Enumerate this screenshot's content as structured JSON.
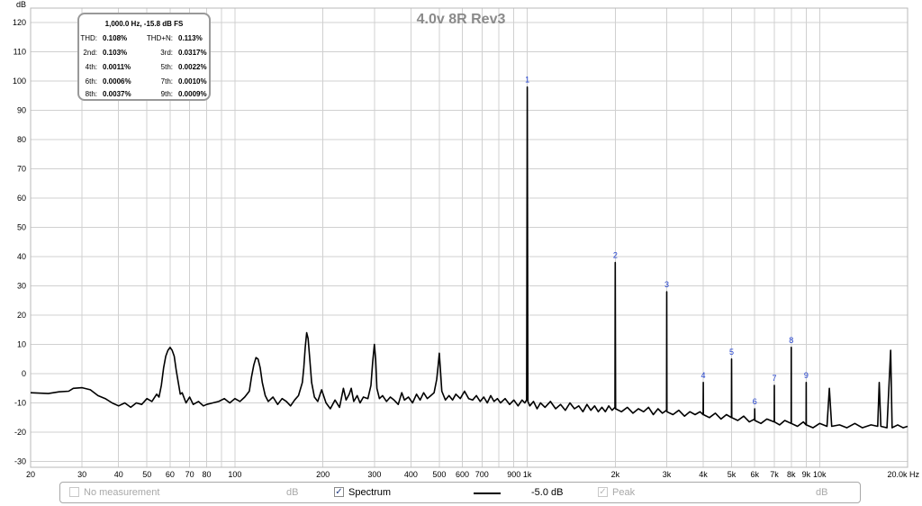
{
  "chart_data": {
    "type": "line",
    "title": "4.0v 8R Rev3",
    "ylabel": "dB",
    "xunit": "Hz",
    "xscale": "log",
    "xlim": [
      20,
      20000
    ],
    "ylim": [
      -32,
      125
    ],
    "grid": true,
    "y_ticks": [
      120,
      110,
      100,
      90,
      80,
      70,
      60,
      50,
      40,
      30,
      20,
      10,
      0,
      -10,
      -20,
      -30
    ],
    "x_ticks": [
      {
        "value": 20,
        "label": "20"
      },
      {
        "value": 30,
        "label": "30"
      },
      {
        "value": 40,
        "label": "40"
      },
      {
        "value": 50,
        "label": "50"
      },
      {
        "value": 60,
        "label": "60"
      },
      {
        "value": 70,
        "label": "70"
      },
      {
        "value": 80,
        "label": "80"
      },
      {
        "value": 100,
        "label": "100"
      },
      {
        "value": 200,
        "label": "200"
      },
      {
        "value": 300,
        "label": "300"
      },
      {
        "value": 400,
        "label": "400"
      },
      {
        "value": 500,
        "label": "500"
      },
      {
        "value": 600,
        "label": "600"
      },
      {
        "value": 700,
        "label": "700"
      },
      {
        "value": 900,
        "label": "900"
      },
      {
        "value": 1000,
        "label": "1k"
      },
      {
        "value": 2000,
        "label": "2k"
      },
      {
        "value": 3000,
        "label": "3k"
      },
      {
        "value": 4000,
        "label": "4k"
      },
      {
        "value": 5000,
        "label": "5k"
      },
      {
        "value": 6000,
        "label": "6k"
      },
      {
        "value": 7000,
        "label": "7k"
      },
      {
        "value": 8000,
        "label": "8k"
      },
      {
        "value": 9000,
        "label": "9k"
      },
      {
        "value": 10000,
        "label": "10k"
      },
      {
        "value": 20000,
        "label": "20.0k Hz"
      }
    ],
    "harmonic_markers": [
      {
        "label": "1",
        "x": 1000,
        "y": 98
      },
      {
        "label": "2",
        "x": 2000,
        "y": 38
      },
      {
        "label": "3",
        "x": 3000,
        "y": 28
      },
      {
        "label": "4",
        "x": 4000,
        "y": -3
      },
      {
        "label": "5",
        "x": 5000,
        "y": 5
      },
      {
        "label": "6",
        "x": 6000,
        "y": -12
      },
      {
        "label": "7",
        "x": 7000,
        "y": -4
      },
      {
        "label": "8",
        "x": 8000,
        "y": 9
      },
      {
        "label": "9",
        "x": 9000,
        "y": -3
      }
    ],
    "series": [
      {
        "name": "Spectrum",
        "color": "#000000",
        "points": [
          [
            20,
            -6.5
          ],
          [
            23,
            -6.8
          ],
          [
            25,
            -6.2
          ],
          [
            27,
            -6.0
          ],
          [
            28,
            -5.0
          ],
          [
            30,
            -4.8
          ],
          [
            32,
            -5.5
          ],
          [
            34,
            -7.5
          ],
          [
            36,
            -8.5
          ],
          [
            38,
            -10.0
          ],
          [
            40,
            -11.0
          ],
          [
            42,
            -10.0
          ],
          [
            44,
            -11.5
          ],
          [
            46,
            -10.0
          ],
          [
            48,
            -10.5
          ],
          [
            50,
            -8.5
          ],
          [
            52,
            -9.5
          ],
          [
            54,
            -7.0
          ],
          [
            55,
            -8.0
          ],
          [
            56,
            -4.0
          ],
          [
            57,
            2.0
          ],
          [
            58,
            6.0
          ],
          [
            59,
            8.0
          ],
          [
            60,
            9.0
          ],
          [
            61,
            8.0
          ],
          [
            62,
            6.0
          ],
          [
            63,
            1.0
          ],
          [
            64,
            -3.0
          ],
          [
            65,
            -7.0
          ],
          [
            66,
            -6.5
          ],
          [
            68,
            -10.0
          ],
          [
            70,
            -8.0
          ],
          [
            72,
            -10.5
          ],
          [
            75,
            -9.5
          ],
          [
            78,
            -11.0
          ],
          [
            80,
            -10.5
          ],
          [
            84,
            -10.0
          ],
          [
            88,
            -9.5
          ],
          [
            92,
            -8.5
          ],
          [
            96,
            -10.0
          ],
          [
            100,
            -8.5
          ],
          [
            104,
            -9.5
          ],
          [
            108,
            -8.0
          ],
          [
            112,
            -6.0
          ],
          [
            114,
            -1.0
          ],
          [
            116,
            3.0
          ],
          [
            118,
            5.5
          ],
          [
            120,
            5.0
          ],
          [
            122,
            2.0
          ],
          [
            124,
            -3.0
          ],
          [
            127,
            -7.5
          ],
          [
            130,
            -9.5
          ],
          [
            135,
            -8.0
          ],
          [
            140,
            -10.5
          ],
          [
            145,
            -8.5
          ],
          [
            150,
            -9.5
          ],
          [
            155,
            -11.0
          ],
          [
            160,
            -9.0
          ],
          [
            165,
            -7.5
          ],
          [
            170,
            -3.0
          ],
          [
            172,
            2.0
          ],
          [
            174,
            9.0
          ],
          [
            176,
            14.0
          ],
          [
            178,
            12.0
          ],
          [
            180,
            6.0
          ],
          [
            183,
            -3.0
          ],
          [
            187,
            -8.0
          ],
          [
            192,
            -9.5
          ],
          [
            198,
            -5.5
          ],
          [
            205,
            -10.0
          ],
          [
            212,
            -12.0
          ],
          [
            220,
            -9.0
          ],
          [
            228,
            -11.5
          ],
          [
            235,
            -5.0
          ],
          [
            240,
            -9.0
          ],
          [
            246,
            -7.0
          ],
          [
            250,
            -5.0
          ],
          [
            255,
            -9.5
          ],
          [
            262,
            -7.5
          ],
          [
            268,
            -10.0
          ],
          [
            275,
            -8.0
          ],
          [
            285,
            -8.5
          ],
          [
            292,
            -4.0
          ],
          [
            296,
            4.0
          ],
          [
            300,
            10.0
          ],
          [
            303,
            5.0
          ],
          [
            306,
            -5.0
          ],
          [
            312,
            -8.5
          ],
          [
            320,
            -7.5
          ],
          [
            330,
            -9.5
          ],
          [
            340,
            -8.0
          ],
          [
            350,
            -9.0
          ],
          [
            362,
            -10.5
          ],
          [
            372,
            -6.5
          ],
          [
            380,
            -9.0
          ],
          [
            392,
            -8.0
          ],
          [
            405,
            -10.0
          ],
          [
            418,
            -7.0
          ],
          [
            430,
            -9.0
          ],
          [
            442,
            -6.5
          ],
          [
            455,
            -8.5
          ],
          [
            468,
            -7.5
          ],
          [
            480,
            -6.5
          ],
          [
            490,
            -2.0
          ],
          [
            496,
            3.0
          ],
          [
            500,
            7.0
          ],
          [
            504,
            2.0
          ],
          [
            510,
            -6.0
          ],
          [
            525,
            -9.0
          ],
          [
            540,
            -7.5
          ],
          [
            555,
            -9.0
          ],
          [
            570,
            -7.0
          ],
          [
            590,
            -8.5
          ],
          [
            610,
            -6.0
          ],
          [
            630,
            -8.5
          ],
          [
            650,
            -9.0
          ],
          [
            670,
            -7.5
          ],
          [
            690,
            -9.5
          ],
          [
            710,
            -8.0
          ],
          [
            730,
            -10.0
          ],
          [
            750,
            -7.5
          ],
          [
            770,
            -9.5
          ],
          [
            790,
            -8.5
          ],
          [
            810,
            -10.0
          ],
          [
            840,
            -8.5
          ],
          [
            870,
            -10.5
          ],
          [
            900,
            -9.0
          ],
          [
            930,
            -11.0
          ],
          [
            960,
            -9.0
          ],
          [
            980,
            -10.0
          ],
          [
            995,
            -9.0
          ],
          [
            1000,
            98.0
          ],
          [
            1005,
            -9.5
          ],
          [
            1020,
            -11.0
          ],
          [
            1050,
            -9.5
          ],
          [
            1080,
            -12.0
          ],
          [
            1110,
            -10.0
          ],
          [
            1150,
            -11.5
          ],
          [
            1200,
            -9.5
          ],
          [
            1250,
            -12.0
          ],
          [
            1300,
            -10.5
          ],
          [
            1350,
            -12.5
          ],
          [
            1400,
            -10.0
          ],
          [
            1450,
            -12.0
          ],
          [
            1500,
            -11.0
          ],
          [
            1550,
            -13.0
          ],
          [
            1600,
            -10.5
          ],
          [
            1650,
            -12.5
          ],
          [
            1700,
            -11.0
          ],
          [
            1750,
            -13.0
          ],
          [
            1800,
            -11.5
          ],
          [
            1850,
            -13.0
          ],
          [
            1900,
            -11.0
          ],
          [
            1950,
            -12.5
          ],
          [
            1995,
            -11.5
          ],
          [
            2000,
            38.0
          ],
          [
            2005,
            -12.0
          ],
          [
            2100,
            -13.0
          ],
          [
            2200,
            -11.5
          ],
          [
            2300,
            -13.5
          ],
          [
            2400,
            -12.0
          ],
          [
            2500,
            -13.0
          ],
          [
            2600,
            -11.5
          ],
          [
            2700,
            -14.0
          ],
          [
            2800,
            -12.0
          ],
          [
            2900,
            -13.5
          ],
          [
            2995,
            -12.5
          ],
          [
            3000,
            28.0
          ],
          [
            3005,
            -13.0
          ],
          [
            3150,
            -14.0
          ],
          [
            3300,
            -12.5
          ],
          [
            3450,
            -14.5
          ],
          [
            3600,
            -13.0
          ],
          [
            3750,
            -14.0
          ],
          [
            3900,
            -13.0
          ],
          [
            3995,
            -14.0
          ],
          [
            4000,
            -3.0
          ],
          [
            4005,
            -14.0
          ],
          [
            4200,
            -15.0
          ],
          [
            4400,
            -13.5
          ],
          [
            4600,
            -15.5
          ],
          [
            4800,
            -14.0
          ],
          [
            4995,
            -15.0
          ],
          [
            5000,
            5.0
          ],
          [
            5005,
            -15.0
          ],
          [
            5250,
            -16.0
          ],
          [
            5500,
            -14.5
          ],
          [
            5750,
            -16.5
          ],
          [
            5995,
            -15.5
          ],
          [
            6000,
            -12.0
          ],
          [
            6005,
            -16.0
          ],
          [
            6300,
            -17.0
          ],
          [
            6600,
            -15.5
          ],
          [
            6995,
            -16.5
          ],
          [
            7000,
            -4.0
          ],
          [
            7005,
            -16.5
          ],
          [
            7300,
            -17.5
          ],
          [
            7600,
            -16.0
          ],
          [
            7995,
            -17.0
          ],
          [
            8000,
            9.0
          ],
          [
            8005,
            -17.0
          ],
          [
            8400,
            -18.0
          ],
          [
            8800,
            -16.5
          ],
          [
            8995,
            -17.5
          ],
          [
            9000,
            -3.0
          ],
          [
            9005,
            -17.5
          ],
          [
            9500,
            -18.5
          ],
          [
            10000,
            -17.0
          ],
          [
            10600,
            -18.0
          ],
          [
            10800,
            -5.0
          ],
          [
            11000,
            -18.0
          ],
          [
            11700,
            -17.5
          ],
          [
            12400,
            -18.5
          ],
          [
            13200,
            -17.0
          ],
          [
            14000,
            -18.5
          ],
          [
            15000,
            -17.5
          ],
          [
            15800,
            -18.0
          ],
          [
            16000,
            -3.0
          ],
          [
            16200,
            -18.0
          ],
          [
            17000,
            -18.5
          ],
          [
            17500,
            8.0
          ],
          [
            17700,
            -18.5
          ],
          [
            18500,
            -17.5
          ],
          [
            19300,
            -18.5
          ],
          [
            20000,
            -18.0
          ]
        ]
      }
    ]
  },
  "info_box": {
    "header": "1,000.0 Hz, -15.8 dB FS",
    "rows": [
      {
        "l1": "THD:",
        "v1": "0.108%",
        "l2": "THD+N:",
        "v2": "0.113%"
      },
      {
        "l1": "2nd:",
        "v1": "0.103%",
        "l2": "3rd:",
        "v2": "0.0317%"
      },
      {
        "l1": "4th:",
        "v1": "0.0011%",
        "l2": "5th:",
        "v2": "0.0022%"
      },
      {
        "l1": "6th:",
        "v1": "0.0006%",
        "l2": "7th:",
        "v2": "0.0010%"
      },
      {
        "l1": "8th:",
        "v1": "0.0037%",
        "l2": "9th:",
        "v2": "0.0009%"
      }
    ]
  },
  "legend": {
    "no_measurement": {
      "label": "No measurement",
      "unit": "dB",
      "checked": false
    },
    "spectrum": {
      "label": "Spectrum",
      "value": "-5.0 dB",
      "checked": true,
      "mark": "✓"
    },
    "peak": {
      "label": "Peak",
      "unit": "dB",
      "checked": true,
      "mark": "✓"
    }
  }
}
